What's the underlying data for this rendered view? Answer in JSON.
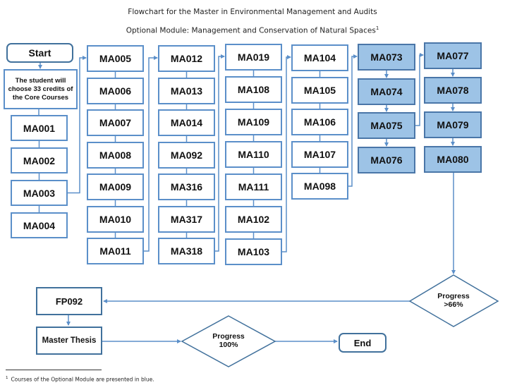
{
  "title": "Flowchart for the Master in Environmental Management and Audits",
  "subtitle": "Optional Module: Management and Conservation of Natural Spaces",
  "subtitle_footnote_mark": "1",
  "colors": {
    "connector": "#5b8fc9",
    "box_border": "#5b8fc9",
    "optional_fill": "#9dc3e6",
    "optional_border": "#4a76a8",
    "diamond_border": "#41719c"
  },
  "start": {
    "label": "Start"
  },
  "intro": {
    "label": "The student will choose 33 credits of the Core Courses"
  },
  "columns": [
    {
      "id": "col1",
      "optional": false,
      "courses": [
        "MA001",
        "MA002",
        "MA003",
        "MA004"
      ]
    },
    {
      "id": "col2",
      "optional": false,
      "courses": [
        "MA005",
        "MA006",
        "MA007",
        "MA008",
        "MA009",
        "MA010",
        "MA011"
      ]
    },
    {
      "id": "col3",
      "optional": false,
      "courses": [
        "MA012",
        "MA013",
        "MA014",
        "MA092",
        "MA316",
        "MA317",
        "MA318"
      ]
    },
    {
      "id": "col4",
      "optional": false,
      "courses": [
        "MA019",
        "MA108",
        "MA109",
        "MA110",
        "MA111",
        "MA102",
        "MA103"
      ]
    },
    {
      "id": "col5",
      "optional": false,
      "courses": [
        "MA104",
        "MA105",
        "MA106",
        "MA107",
        "MA098"
      ]
    },
    {
      "id": "col6",
      "optional": true,
      "courses": [
        "MA073",
        "MA074",
        "MA075",
        "MA076"
      ]
    },
    {
      "id": "col7",
      "optional": true,
      "courses": [
        "MA077",
        "MA078",
        "MA079",
        "MA080"
      ]
    }
  ],
  "decision_66": {
    "line1": "Progress",
    "line2": ">66%"
  },
  "fp092": {
    "label": "FP092"
  },
  "thesis": {
    "label": "Master Thesis"
  },
  "decision_100": {
    "line1": "Progress",
    "line2": "100%"
  },
  "end": {
    "label": "End"
  },
  "footnote": {
    "mark": "1",
    "text": "Courses of the Optional Module are presented in blue."
  }
}
